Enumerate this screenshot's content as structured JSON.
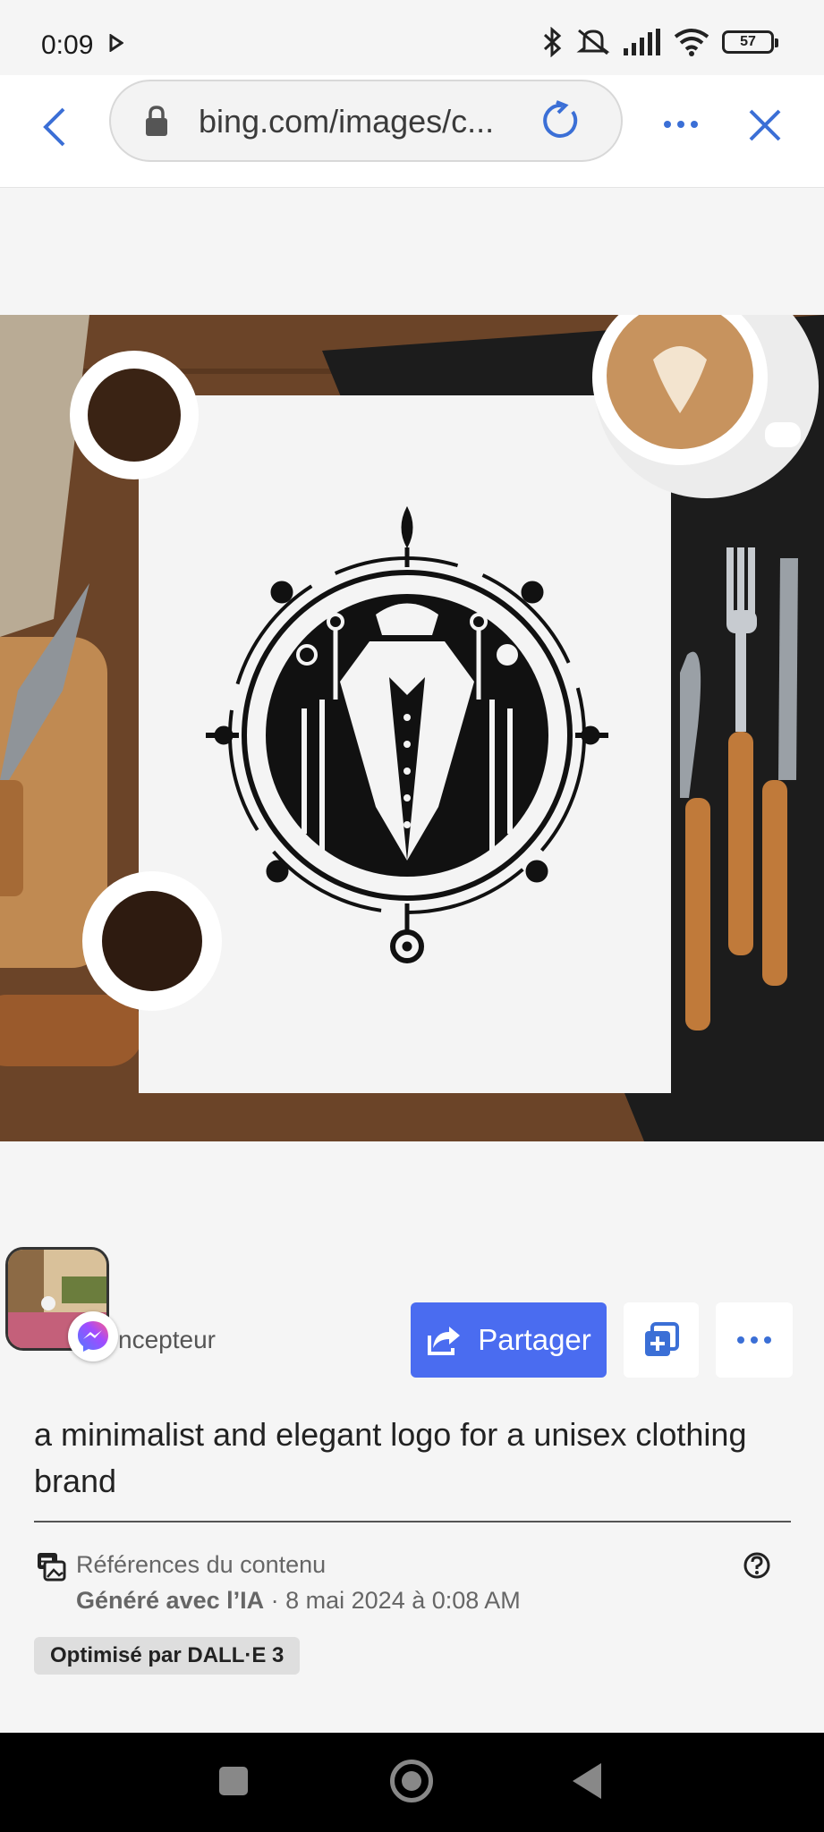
{
  "status": {
    "time": "0:09",
    "battery": "57"
  },
  "browser": {
    "url": "bing.com/images/c..."
  },
  "image": {
    "description_alt": "a minimalist and elegant logo for a unisex clothing brand"
  },
  "actions": {
    "creator_label": "ncepteur",
    "share_label": "Partager"
  },
  "prompt": "a minimalist and elegant logo for a unisex clothing brand",
  "references": {
    "title": "Références du contenu",
    "generated": "Généré avec l’IA",
    "date": " · 8 mai 2024 à 0:08 AM",
    "badge": "Optimisé par DALL·E 3"
  },
  "colors": {
    "accent": "#4a6cf0",
    "link_icon": "#3b6fd6"
  }
}
